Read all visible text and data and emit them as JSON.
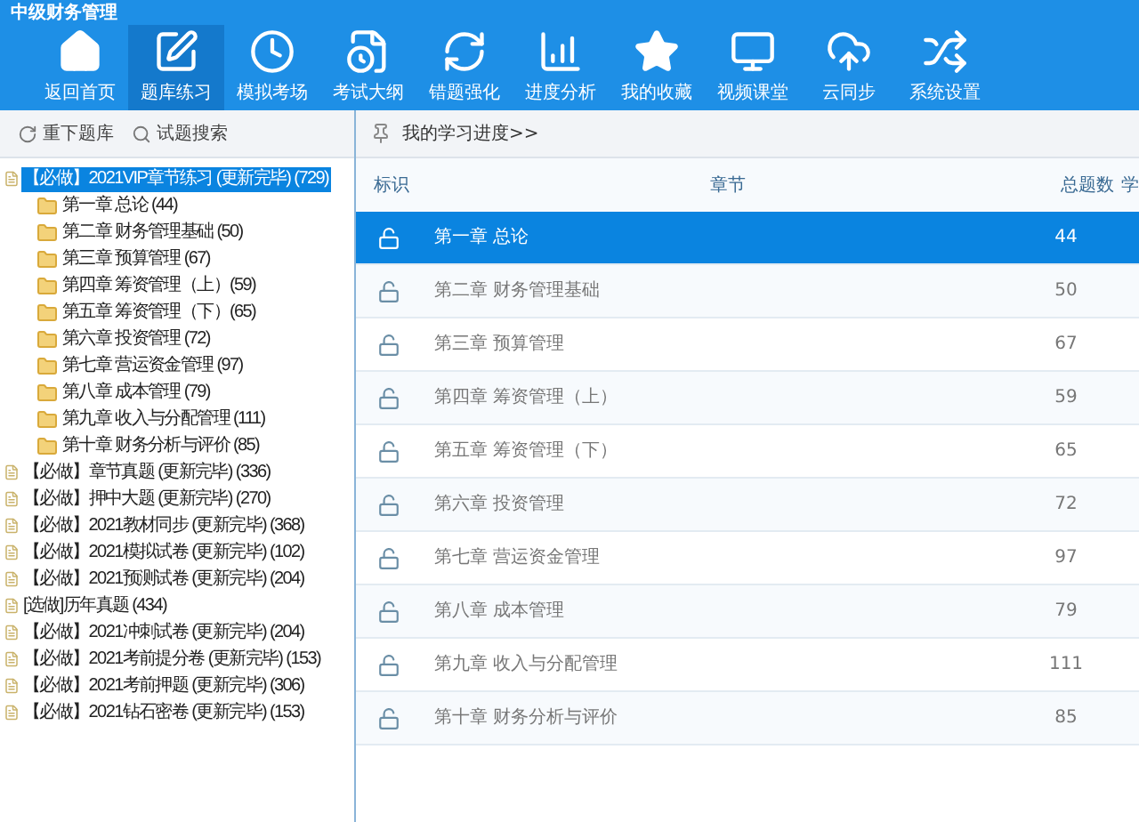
{
  "window": {
    "title": "中级财务管理"
  },
  "toolbar": [
    {
      "label": "返回首页",
      "selected": false
    },
    {
      "label": "题库练习",
      "selected": true
    },
    {
      "label": "模拟考场",
      "selected": false
    },
    {
      "label": "考试大纲",
      "selected": false
    },
    {
      "label": "错题强化",
      "selected": false
    },
    {
      "label": "进度分析",
      "selected": false
    },
    {
      "label": "我的收藏",
      "selected": false
    },
    {
      "label": "视频课堂",
      "selected": false
    },
    {
      "label": "云同步",
      "selected": false
    },
    {
      "label": "系统设置",
      "selected": false
    }
  ],
  "sidebar": {
    "actions": [
      {
        "label": "重下题库"
      },
      {
        "label": "试题搜索"
      }
    ],
    "tree": [
      {
        "label": "【必做】2021VIP章节练习 (更新完毕) (729)",
        "selected": true,
        "children": [
          {
            "label": "第一章 总论 (44)",
            "selected": false
          },
          {
            "label": "第二章 财务管理基础 (50)",
            "selected": false
          },
          {
            "label": "第三章 预算管理 (67)",
            "selected": false
          },
          {
            "label": "第四章 筹资管理（上）(59)",
            "selected": false
          },
          {
            "label": "第五章 筹资管理（下）(65)",
            "selected": false
          },
          {
            "label": "第六章 投资管理 (72)",
            "selected": false
          },
          {
            "label": "第七章 营运资金管理 (97)",
            "selected": false
          },
          {
            "label": "第八章 成本管理 (79)",
            "selected": false
          },
          {
            "label": "第九章 收入与分配管理 (111)",
            "selected": false
          },
          {
            "label": "第十章 财务分析与评价 (85)",
            "selected": false
          }
        ]
      },
      {
        "label": "【必做】章节真题 (更新完毕) (336)",
        "selected": false
      },
      {
        "label": "【必做】押中大题 (更新完毕) (270)",
        "selected": false
      },
      {
        "label": "【必做】2021教材同步 (更新完毕) (368)",
        "selected": false
      },
      {
        "label": "【必做】2021模拟试卷 (更新完毕) (102)",
        "selected": false
      },
      {
        "label": "【必做】2021预测试卷 (更新完毕) (204)",
        "selected": false
      },
      {
        "label": "[选做]历年真题 (434)",
        "selected": false
      },
      {
        "label": "【必做】2021冲刺试卷 (更新完毕) (204)",
        "selected": false
      },
      {
        "label": "【必做】2021考前提分卷 (更新完毕) (153)",
        "selected": false
      },
      {
        "label": "【必做】2021考前押题 (更新完毕) (306)",
        "selected": false
      },
      {
        "label": "【必做】2021钻石密卷 (更新完毕) (153)",
        "selected": false
      }
    ]
  },
  "breadcrumb": "我的学习进度>>",
  "table": {
    "columns": [
      "标识",
      "章节",
      "总题数",
      "学"
    ],
    "rows": [
      {
        "chapter": "第一章 总论",
        "total": "44",
        "selected": true
      },
      {
        "chapter": "第二章 财务管理基础",
        "total": "50",
        "selected": false
      },
      {
        "chapter": "第三章 预算管理",
        "total": "67",
        "selected": false
      },
      {
        "chapter": "第四章 筹资管理（上）",
        "total": "59",
        "selected": false
      },
      {
        "chapter": "第五章 筹资管理（下）",
        "total": "65",
        "selected": false
      },
      {
        "chapter": "第六章 投资管理",
        "total": "72",
        "selected": false
      },
      {
        "chapter": "第七章 营运资金管理",
        "total": "97",
        "selected": false
      },
      {
        "chapter": "第八章 成本管理",
        "total": "79",
        "selected": false
      },
      {
        "chapter": "第九章 收入与分配管理",
        "total": "111",
        "selected": false
      },
      {
        "chapter": "第十章 财务分析与评价",
        "total": "85",
        "selected": false
      }
    ]
  }
}
